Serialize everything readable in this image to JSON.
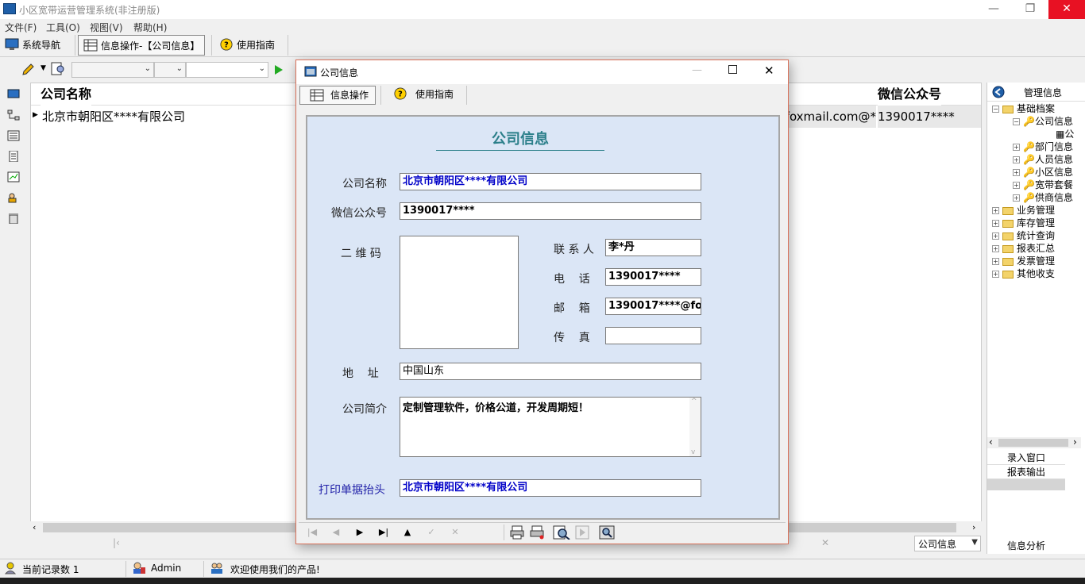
{
  "window": {
    "title": "小区宽带运营管理系统(非注册版)"
  },
  "menu": [
    "文件(F)",
    "工具(O)",
    "视图(V)",
    "帮助(H)"
  ],
  "maintoolbar": {
    "nav_label": "系统导航",
    "info_op_label": "信息操作-【公司信息】",
    "guide_label": "使用指南"
  },
  "grid": {
    "columns": [
      "公司名称",
      "微信公众号"
    ],
    "row": {
      "company": "北京市朝阳区****有限公司",
      "email_partial": "*@foxmail.com",
      "wechat": "1390017****"
    }
  },
  "right_panel": {
    "title": "管理信息",
    "tree": [
      {
        "label": "基础档案",
        "children": [
          "公司信息",
          "部门信息",
          "人员信息",
          "小区信息",
          "宽带套餐",
          "供商信息"
        ]
      },
      {
        "label": "业务管理"
      },
      {
        "label": "库存管理"
      },
      {
        "label": "统计查询"
      },
      {
        "label": "报表汇总"
      },
      {
        "label": "发票管理"
      },
      {
        "label": "其他收支"
      }
    ],
    "child_visible_text": [
      "公",
      "部门信息",
      "人员信息",
      "小区信息",
      "宽带套餐",
      "供商信息"
    ],
    "links": [
      "录入窗口",
      "报表输出"
    ],
    "bottom_label": "信息分析"
  },
  "grid_footer": {
    "selector_value": "公司信息"
  },
  "status": {
    "record_count": "当前记录数 1",
    "user": "Admin",
    "welcome": "欢迎使用我们的产品!"
  },
  "dialog": {
    "title": "公司信息",
    "toolbar": {
      "info_op": "信息操作",
      "guide": "使用指南"
    },
    "form": {
      "heading": "公司信息",
      "company_name_label": "公司名称",
      "company_name": "北京市朝阳区****有限公司",
      "wechat_label": "微信公众号",
      "wechat": "1390017****",
      "qrcode_label": "二 维 码",
      "contact_label": "联 系 人",
      "contact": "李*丹",
      "phone_label": "电    话",
      "phone": "1390017****",
      "email_label": "邮    箱",
      "email": "1390017****@fo:",
      "fax_label": "传    真",
      "fax": "",
      "address_label": "地    址",
      "address": "中国山东",
      "intro_label": "公司简介",
      "intro": "定制管理软件，价格公道，开发周期短！",
      "print_header_label": "打印单据抬头",
      "print_header": "北京市朝阳区****有限公司"
    }
  },
  "colors": {
    "form_bg": "#dbe6f6",
    "heading": "#2b7f8a",
    "field_text": "#0000c8",
    "close_red": "#e81123"
  }
}
